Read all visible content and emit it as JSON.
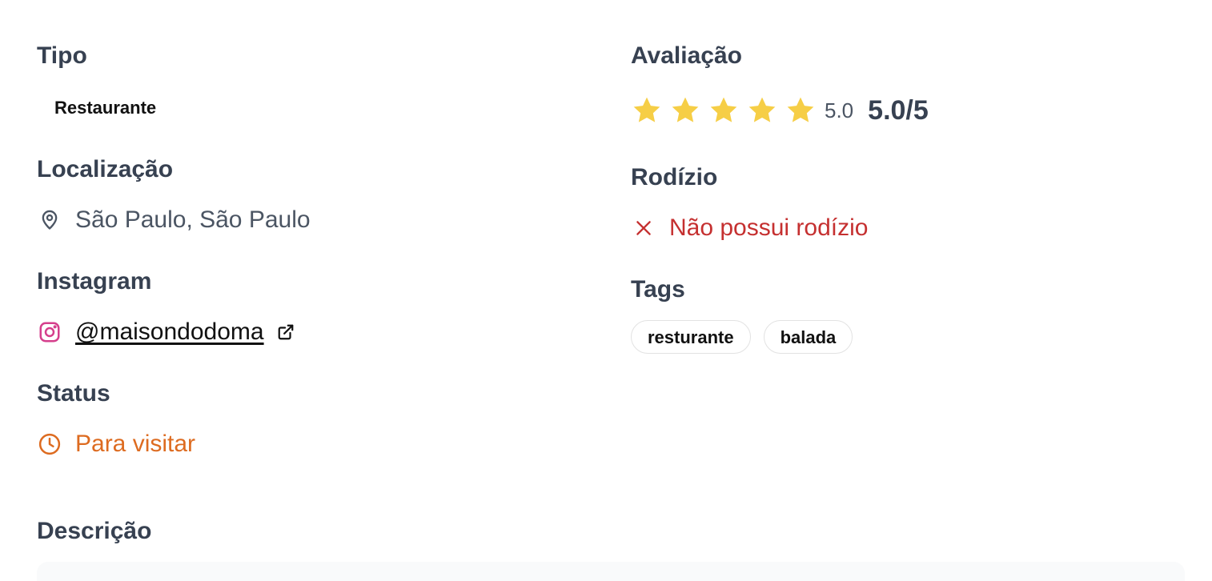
{
  "left": {
    "tipo": {
      "label": "Tipo",
      "value": "Restaurante"
    },
    "localizacao": {
      "label": "Localização",
      "value": "São Paulo, São Paulo",
      "icon": "map-pin-icon"
    },
    "instagram": {
      "label": "Instagram",
      "handle": "@maisondodoma",
      "icon": "instagram-icon",
      "link_icon": "external-link-icon"
    },
    "status": {
      "label": "Status",
      "value": "Para visitar",
      "icon": "clock-icon",
      "color": "#dd6b20"
    }
  },
  "right": {
    "avaliacao": {
      "label": "Avaliação",
      "stars": 5,
      "max_stars": 5,
      "score_small": "5.0",
      "score_big": "5.0/5",
      "star_color": "#f6ce46"
    },
    "rodizio": {
      "label": "Rodízio",
      "value": "Não possui rodízio",
      "icon": "x-icon",
      "color": "#c53030"
    },
    "tags": {
      "label": "Tags",
      "items": [
        "resturante",
        "balada"
      ]
    }
  },
  "descricao": {
    "label": "Descrição"
  }
}
